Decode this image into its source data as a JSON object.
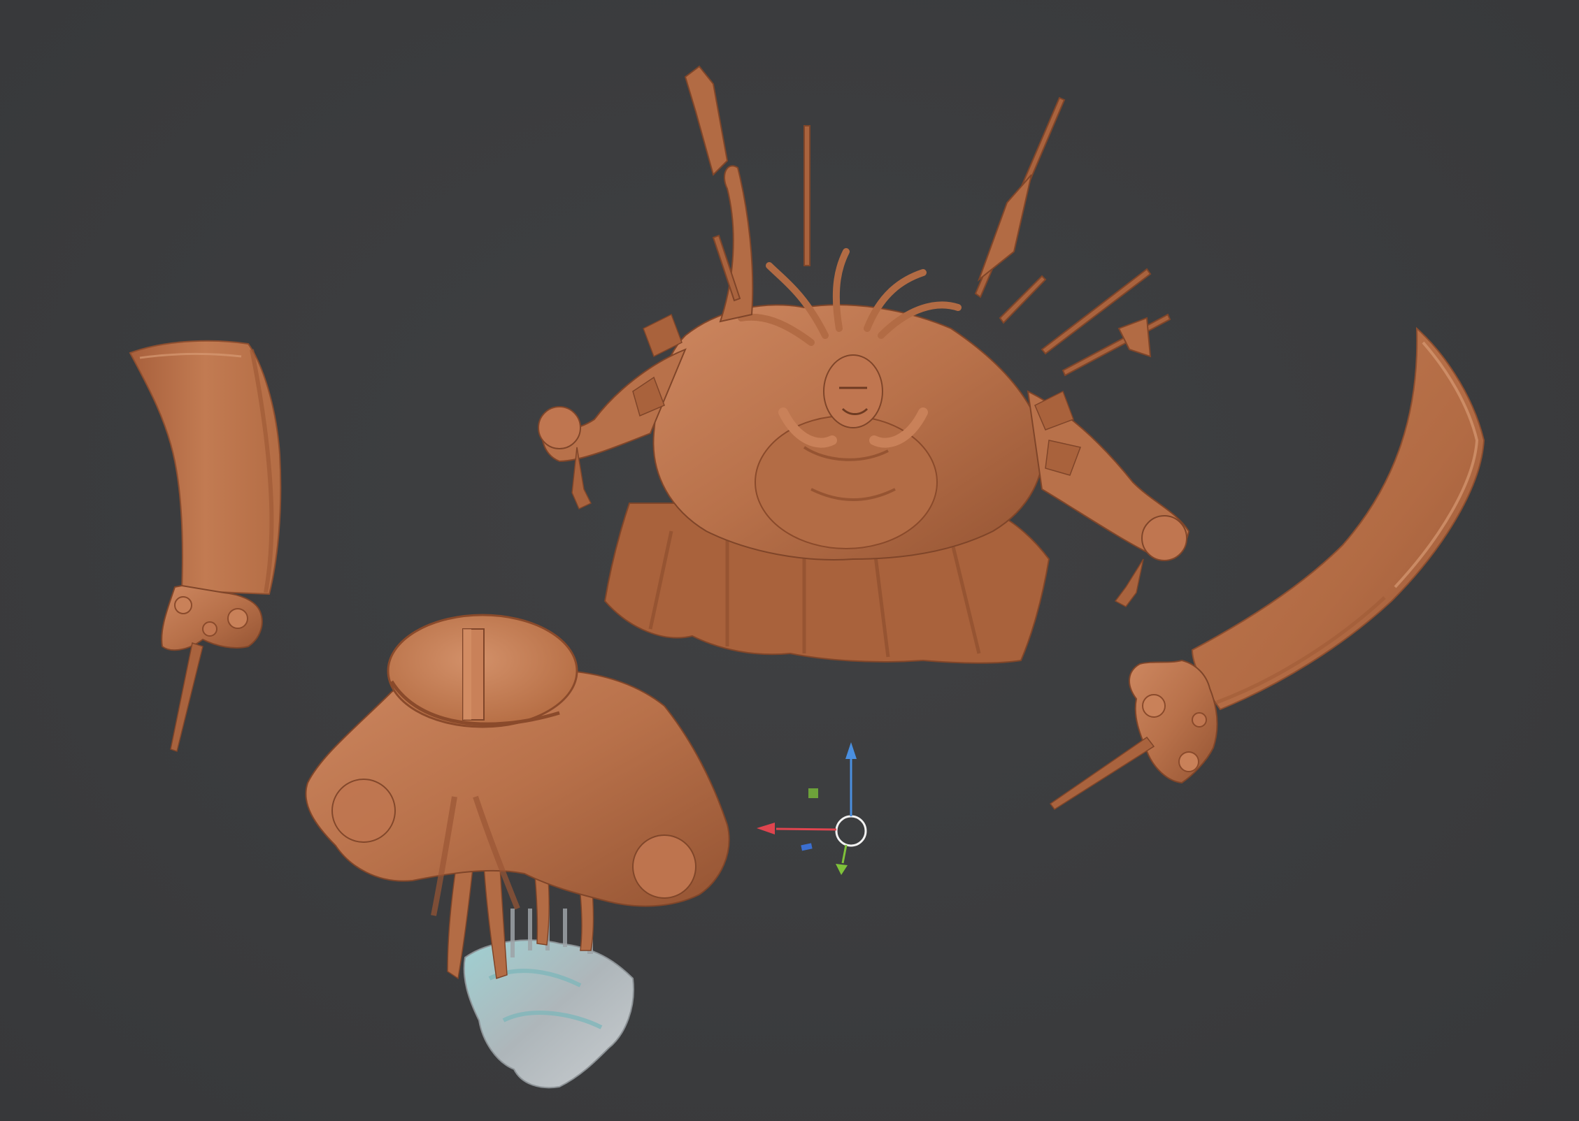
{
  "viewport": {
    "background_color": "#3a3b3d",
    "clay_color": "#b8714a",
    "clay_shadow": "#8d4e2f",
    "clay_highlight": "#cf8a61",
    "support_color": "#a9b0b4",
    "support_tint": "#8fc9cc"
  },
  "objects": [
    {
      "name": "left-blade",
      "icon": "curved-sword-blade"
    },
    {
      "name": "right-blade",
      "icon": "curved-sword-blade"
    },
    {
      "name": "warrior-torso",
      "icon": "armored-warrior-bust"
    },
    {
      "name": "warrior-base",
      "icon": "horse-legs-on-rock-base"
    }
  ],
  "gizmo": {
    "icon": "3d-cursor-transform-gizmo",
    "axis_colors": {
      "x": "#e0454f",
      "y": "#7fc23a",
      "z": "#4a8fe0",
      "plane_green": "#6da23a",
      "plane_blue": "#3b6fd0"
    }
  }
}
